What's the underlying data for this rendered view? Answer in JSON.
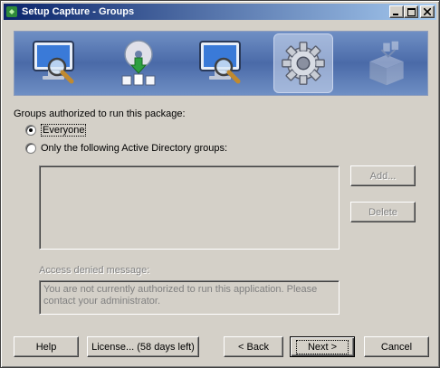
{
  "window": {
    "title": "Setup Capture - Groups",
    "buttons": {
      "minimize": "_",
      "maximize": "□",
      "close": "✕"
    }
  },
  "banner": {
    "steps": [
      {
        "icon": "monitor-magnifier-icon"
      },
      {
        "icon": "disc-download-icon"
      },
      {
        "icon": "monitor-magnifier-icon"
      },
      {
        "icon": "gear-icon",
        "active": true
      },
      {
        "icon": "package-icon",
        "disabled": true
      }
    ]
  },
  "groups": {
    "label": "Groups authorized to run this package:",
    "everyone_label": "Everyone",
    "everyone_checked": true,
    "ad_groups_label": "Only the following Active Directory groups:",
    "ad_groups_checked": false,
    "add_button": "Add...",
    "delete_button": "Delete"
  },
  "denied": {
    "label": "Access denied message:",
    "message": "You are not currently authorized to run this application. Please\ncontact your administrator."
  },
  "footer": {
    "help": "Help",
    "license": "License... (58 days left)",
    "back": "< Back",
    "next": "Next >",
    "cancel": "Cancel"
  },
  "colors": {
    "titlebar_start": "#0a246a",
    "titlebar_end": "#a6caf0",
    "banner": "#4a6aa8",
    "face": "#d4d0c8"
  }
}
